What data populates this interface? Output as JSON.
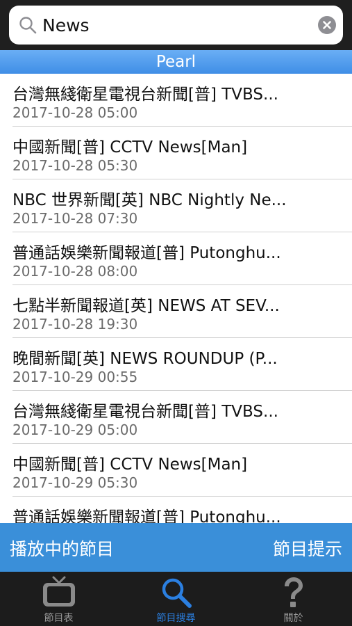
{
  "search": {
    "value": "News"
  },
  "section": {
    "title": "Pearl"
  },
  "programs": [
    {
      "title": "台灣無綫衛星電視台新聞[普] TVBS...",
      "time": "2017-10-28 05:00"
    },
    {
      "title": "中國新聞[普] CCTV News[Man]",
      "time": "2017-10-28 05:30"
    },
    {
      "title": "NBC 世界新聞[英] NBC Nightly Ne...",
      "time": "2017-10-28 07:30"
    },
    {
      "title": "普通話娛樂新聞報道[普] Putonghu...",
      "time": "2017-10-28 08:00"
    },
    {
      "title": "七點半新聞報道[英] NEWS AT SEV...",
      "time": "2017-10-28 19:30"
    },
    {
      "title": "晚間新聞[英] NEWS ROUNDUP (P...",
      "time": "2017-10-29 00:55"
    },
    {
      "title": "台灣無綫衛星電視台新聞[普] TVBS...",
      "time": "2017-10-29 05:00"
    },
    {
      "title": "中國新聞[普] CCTV News[Man]",
      "time": "2017-10-29 05:30"
    },
    {
      "title": "普通話娛樂新聞報道[普] Putonghu...",
      "time": ""
    }
  ],
  "action_bar": {
    "left": "播放中的節目",
    "right": "節目提示"
  },
  "tabs": [
    {
      "label": "節目表",
      "icon": "tv-icon",
      "active": false
    },
    {
      "label": "節目搜尋",
      "icon": "search-icon",
      "active": true
    },
    {
      "label": "關於",
      "icon": "question-icon",
      "active": false
    }
  ],
  "colors": {
    "accent": "#3a8fd9",
    "header": "#4f9bec",
    "active_tab": "#2b7fe0"
  }
}
